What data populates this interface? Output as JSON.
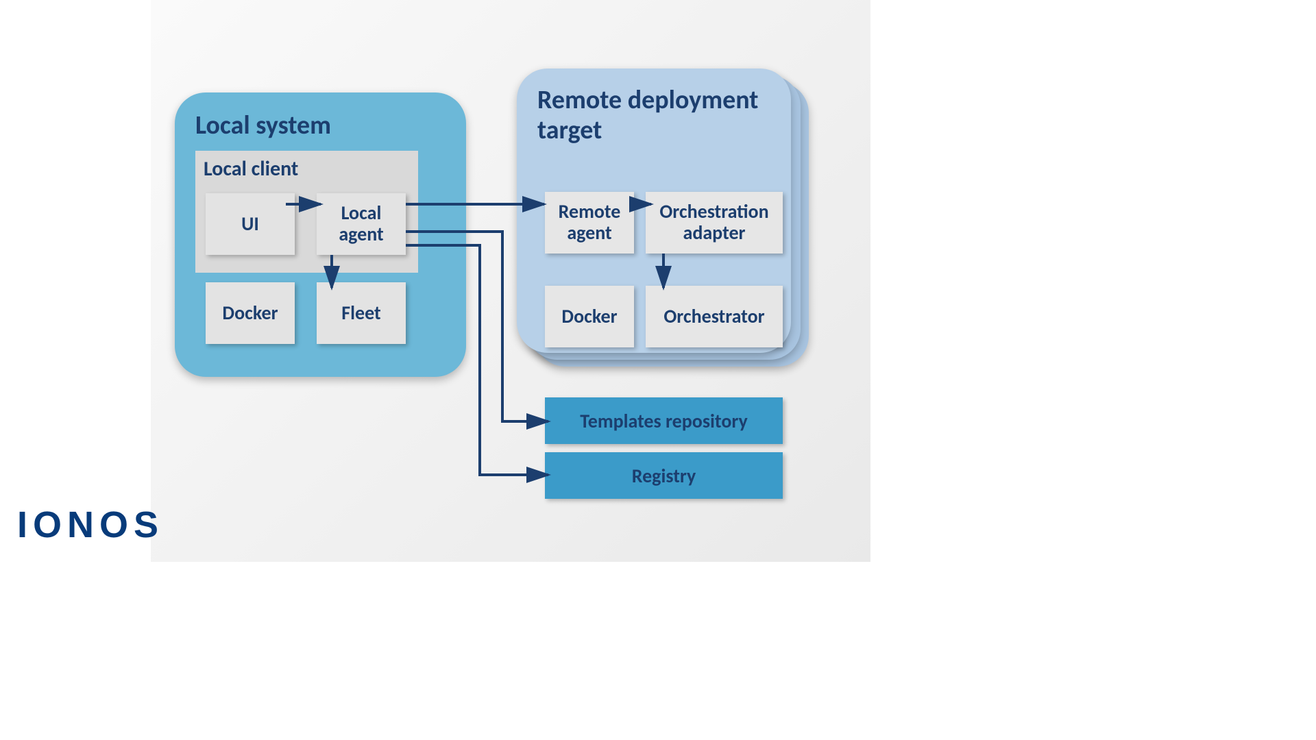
{
  "local": {
    "title": "Local system",
    "client_title": "Local client",
    "ui": "UI",
    "local_agent": "Local agent",
    "docker": "Docker",
    "fleet": "Fleet"
  },
  "remote": {
    "title": "Remote deployment target",
    "remote_agent": "Remote agent",
    "orch_adapter": "Orchestration adapter",
    "docker": "Docker",
    "orchestrator": "Orchestrator"
  },
  "repos": {
    "templates": "Templates repository",
    "registry": "Registry"
  },
  "brand": "IONOS",
  "colors": {
    "arrow": "#1c3e6e",
    "local_bg": "#6cb8d8",
    "remote_bg": "#b7d0e8",
    "repo_bg": "#3b9bc9",
    "text": "#1c3e6e"
  }
}
